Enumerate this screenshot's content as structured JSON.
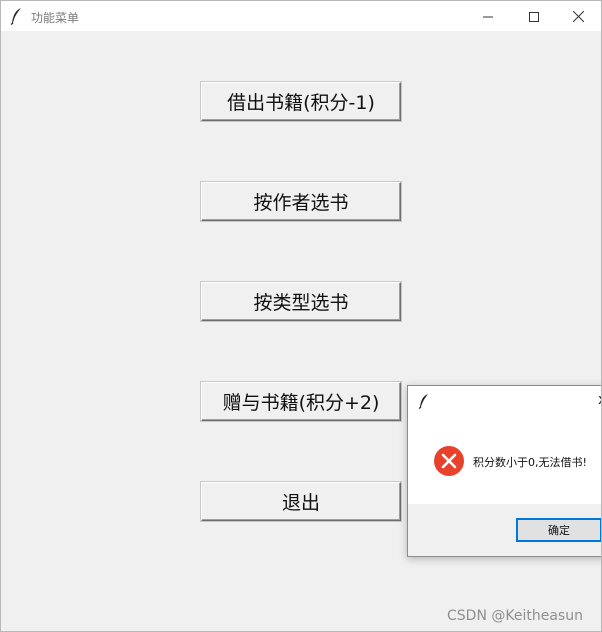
{
  "window": {
    "title": "功能菜单"
  },
  "menu": {
    "borrow_label": "借出书籍(积分-1)",
    "by_author_label": "按作者选书",
    "by_type_label": "按类型选书",
    "donate_label": "赠与书籍(积分+2)",
    "exit_label": "退出"
  },
  "dialog": {
    "close_glyph": "x",
    "message": "积分数小于0,无法借书!",
    "ok_label": "确定"
  },
  "watermark": "CSDN @Keitheasun",
  "colors": {
    "error_red": "#e8412c",
    "focus_blue": "#0078d7",
    "window_bg": "#f0f0f0"
  },
  "icons": {
    "app": "feather-icon",
    "minimize": "minimize-icon",
    "maximize": "maximize-icon",
    "close": "close-icon",
    "error": "error-icon"
  }
}
